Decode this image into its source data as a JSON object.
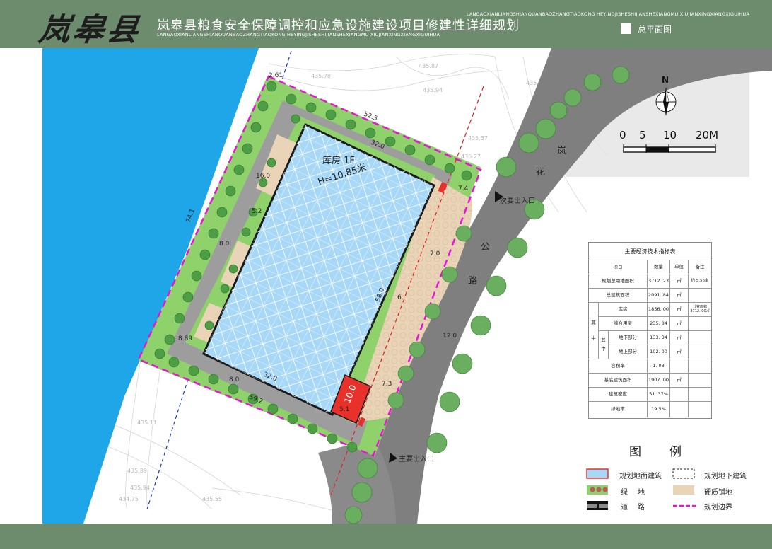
{
  "header": {
    "logo_text": "岚皋县",
    "title": "岚皋县粮食安全保障调控和应急设施建设项目修建性详细规划",
    "subtitle": "LANGAOXIANLIANGSHIANQUANBAOZHANGTIAOKONG HEYINGJISHESHIJIANSHEXIANGMU XIUJIANXINGXIANGXIGUIHUA",
    "sheet_name": "总平面图"
  },
  "footer": {
    "text": "LANGAOXIANLIANGSHIANQUANBAOZHANGTIAOKONG HEYINGJISHESHIJIANSHEXIANGMU XIUJIANXINGXIANGXIGUIHUA"
  },
  "compass": {
    "north": "N"
  },
  "scale": {
    "labels": [
      "0",
      "5",
      "10",
      "20M"
    ]
  },
  "road": {
    "chars": [
      "岚",
      "花",
      "公",
      "路"
    ],
    "secondary_entrance": "次要出入口",
    "main_entrance": "主要出入口"
  },
  "warehouse": {
    "name": "库房  1F",
    "height": "H=10.85米"
  },
  "complex_building": {
    "area": "10.0"
  },
  "dimensions": [
    "52.5",
    "32.0",
    "74.1",
    "16.0",
    "5.2",
    "8.0",
    "58.0",
    "7.0",
    "6.",
    "12.0",
    "7.4",
    "7.3",
    "32.0",
    "59.2",
    "8.0",
    "5.1",
    "2.61",
    "8.89"
  ],
  "colors": {
    "water": "#1ea6e8",
    "building": "#a8d8f8",
    "complex": "#e8312a",
    "green": "#8fd16a",
    "paving": "#ead4b8",
    "road": "#7f7f7f",
    "boundary": "#e815d8",
    "header": "#6d8c6d"
  },
  "spec_table": {
    "title": "主要经济技术指标表",
    "headers": [
      "项目",
      "数量",
      "单位",
      "备注"
    ],
    "rows": [
      {
        "item": "规划总用地面积",
        "qty": "3712. 23",
        "unit": "㎡",
        "note": "约 5.56亩"
      },
      {
        "item": "总建筑面积",
        "qty": "2091. 84",
        "unit": "㎡",
        "note": ""
      },
      {
        "item": "库房",
        "qty": "1856. 00",
        "unit": "㎡",
        "note": "计容面积 3712. 00㎡"
      },
      {
        "item": "综合用房",
        "qty": "235. 84",
        "unit": "㎡",
        "note": ""
      },
      {
        "item": "地下部分",
        "qty": "133. 84",
        "unit": "㎡",
        "note": ""
      },
      {
        "item": "地上部分",
        "qty": "102. 00",
        "unit": "㎡",
        "note": ""
      },
      {
        "item": "容积率",
        "qty": "1. 03",
        "unit": "",
        "note": ""
      },
      {
        "item": "基底建筑面积",
        "qty": "1907. 00",
        "unit": "㎡",
        "note": ""
      },
      {
        "item": "建筑密度",
        "qty": "51. 37%",
        "unit": "",
        "note": ""
      },
      {
        "item": "绿地率",
        "qty": "19.5%",
        "unit": "",
        "note": ""
      }
    ],
    "group_labels": {
      "qi1": "其",
      "zhong1": "中",
      "qi2": "其",
      "zhong2": "中"
    }
  },
  "legend": {
    "title": "图例",
    "items": [
      "规划地面建筑",
      "规划地下建筑",
      "绿地",
      "硬质铺地",
      "道路",
      "规划边界"
    ]
  }
}
